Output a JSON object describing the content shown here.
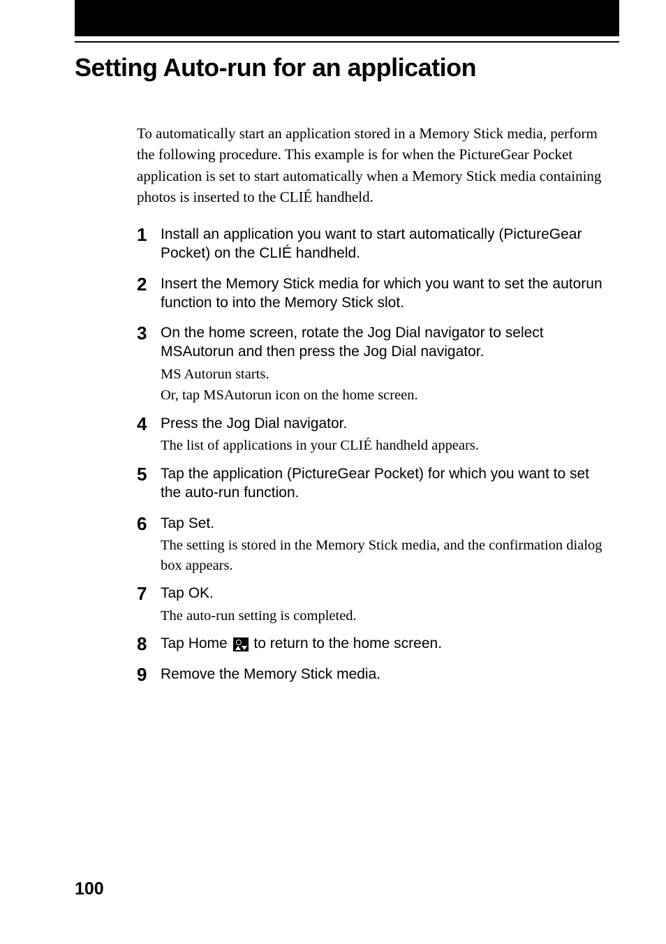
{
  "title": "Setting Auto-run for an application",
  "intro": "To automatically start an application stored in a Memory Stick media, perform the following procedure. This example is for when the PictureGear Pocket application is set to start automatically when a Memory Stick media containing photos is inserted to the CLIÉ handheld.",
  "steps": [
    {
      "num": "1",
      "title": "Install an application you want to start automatically (PictureGear Pocket) on the CLIÉ handheld.",
      "desc": []
    },
    {
      "num": "2",
      "title": "Insert the Memory Stick media for which you want to set the autorun function to into the Memory Stick slot.",
      "desc": []
    },
    {
      "num": "3",
      "title": "On the home screen, rotate the Jog Dial navigator to select MSAutorun and then press the Jog Dial navigator.",
      "desc": [
        "MS Autorun starts.",
        "Or, tap MSAutorun icon on the home screen."
      ]
    },
    {
      "num": "4",
      "title": "Press the Jog Dial navigator.",
      "desc": [
        "The list of applications in your CLIÉ handheld appears."
      ]
    },
    {
      "num": "5",
      "title": "Tap the application (PictureGear Pocket) for which you want to set the auto-run function.",
      "desc": []
    },
    {
      "num": "6",
      "title": "Tap Set.",
      "desc": [
        "The setting is stored in the Memory Stick media, and the confirmation dialog box appears."
      ]
    },
    {
      "num": "7",
      "title": "Tap OK.",
      "desc": [
        "The auto-run setting is completed."
      ]
    },
    {
      "num": "8",
      "title_prefix": "Tap Home ",
      "title_suffix": " to return to the home screen.",
      "has_icon": true,
      "desc": []
    },
    {
      "num": "9",
      "title": "Remove the Memory Stick media.",
      "desc": []
    }
  ],
  "page_number": "100"
}
